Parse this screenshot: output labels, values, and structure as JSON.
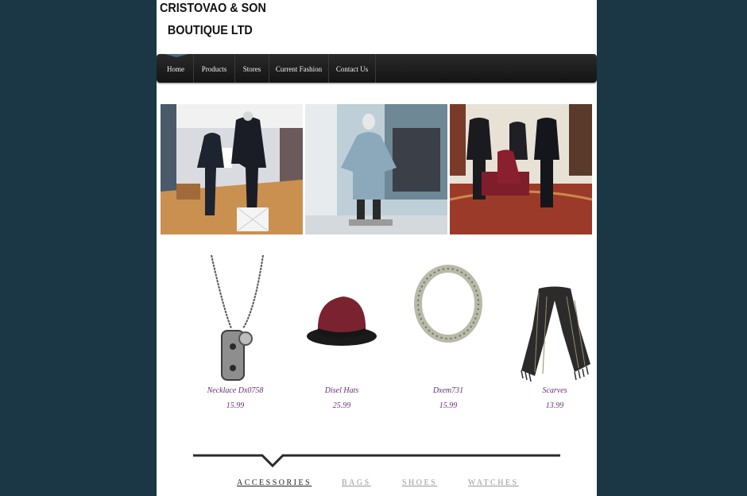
{
  "brand": {
    "line1": "CRISTOVAO & SON",
    "line2": "BOUTIQUE LTD"
  },
  "nav": {
    "items": [
      "Home",
      "Products",
      "Stores",
      "Current Fashion",
      "Contact Us"
    ]
  },
  "products": [
    {
      "name": "Necklace Dx0758",
      "price": "15.99"
    },
    {
      "name": "Disel Hats",
      "price": "25.99"
    },
    {
      "name": "Dxem731",
      "price": "15.99"
    },
    {
      "name": "Scarves",
      "price": "13.99"
    }
  ],
  "tabs": {
    "items": [
      "ACCESSORIES",
      "BAGS",
      "SHOES",
      "WATCHES"
    ],
    "active": "ACCESSORIES"
  }
}
